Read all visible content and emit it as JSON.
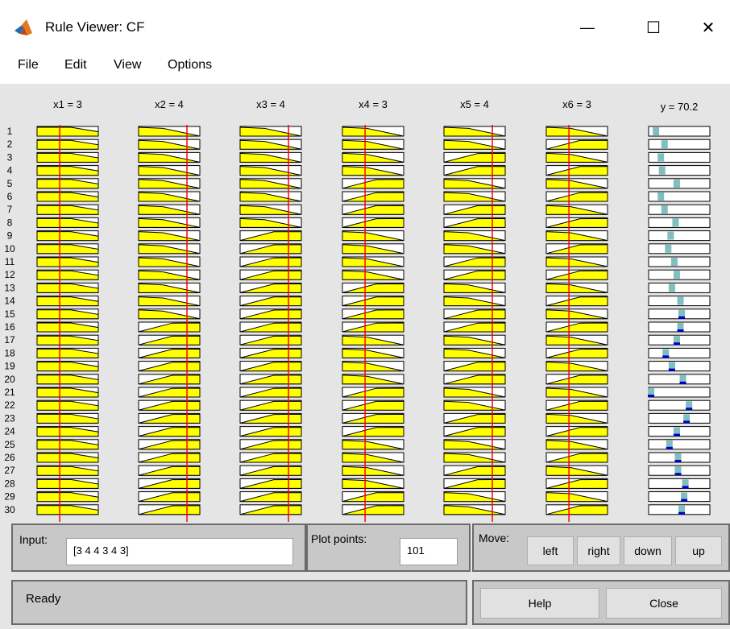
{
  "window": {
    "title": "Rule Viewer: CF",
    "minimize_glyph": "—",
    "maximize_glyph": "☐",
    "close_glyph": "✕"
  },
  "menu": [
    "File",
    "Edit",
    "View",
    "Options"
  ],
  "plot": {
    "input_headers": [
      "x1 = 3",
      "x2 = 4",
      "x3 = 4",
      "x4 = 3",
      "x5 = 4",
      "x6 = 3"
    ],
    "output_header": "y = 70.2",
    "rule_numbers": [
      "1",
      "2",
      "3",
      "4",
      "5",
      "6",
      "7",
      "8",
      "9",
      "10",
      "11",
      "12",
      "13",
      "14",
      "15",
      "16",
      "17",
      "18",
      "19",
      "20",
      "21",
      "22",
      "23",
      "24",
      "25",
      "26",
      "27",
      "28",
      "29",
      "30"
    ],
    "input_values_fraction": [
      0.37,
      0.79,
      0.79,
      0.37,
      0.79,
      0.37
    ],
    "input_mf_shapes": [
      [
        "F",
        "F",
        "F",
        "F",
        "F",
        "F",
        "F",
        "F",
        "F",
        "F",
        "F",
        "F",
        "F",
        "F",
        "F",
        "F",
        "F",
        "F",
        "F",
        "F",
        "F",
        "F",
        "F",
        "F",
        "F",
        "F",
        "F",
        "F",
        "F",
        "F"
      ],
      [
        "D",
        "D",
        "D",
        "D",
        "D",
        "D",
        "D",
        "D",
        "D",
        "D",
        "D",
        "D",
        "D",
        "D",
        "D",
        "U",
        "U",
        "U",
        "U",
        "U",
        "U",
        "U",
        "U",
        "U",
        "U",
        "U",
        "U",
        "U",
        "U",
        "U"
      ],
      [
        "D",
        "D",
        "D",
        "D",
        "D",
        "D",
        "D",
        "D",
        "U",
        "U",
        "U",
        "U",
        "U",
        "U",
        "U",
        "U",
        "U",
        "U",
        "U",
        "U",
        "U",
        "U",
        "U",
        "U",
        "U",
        "U",
        "U",
        "U",
        "U",
        "U"
      ],
      [
        "D",
        "D",
        "D",
        "D",
        "U",
        "U",
        "U",
        "U",
        "D",
        "D",
        "D",
        "D",
        "U",
        "U",
        "U",
        "U",
        "D",
        "D",
        "D",
        "D",
        "U",
        "U",
        "U",
        "U",
        "D",
        "D",
        "D",
        "D",
        "U",
        "U"
      ],
      [
        "D",
        "D",
        "U",
        "U",
        "D",
        "D",
        "U",
        "U",
        "D",
        "D",
        "U",
        "U",
        "D",
        "D",
        "U",
        "U",
        "D",
        "D",
        "U",
        "U",
        "D",
        "D",
        "U",
        "U",
        "D",
        "D",
        "U",
        "U",
        "D",
        "D"
      ],
      [
        "D",
        "U",
        "D",
        "U",
        "D",
        "U",
        "D",
        "U",
        "D",
        "U",
        "D",
        "U",
        "D",
        "U",
        "D",
        "U",
        "D",
        "U",
        "D",
        "U",
        "D",
        "U",
        "D",
        "U",
        "D",
        "U",
        "D",
        "U",
        "D",
        "U"
      ]
    ],
    "output_rule_levels": [
      0.12,
      0.26,
      0.2,
      0.22,
      0.46,
      0.2,
      0.26,
      0.44,
      0.36,
      0.32,
      0.42,
      0.46,
      0.38,
      0.52,
      0.54,
      0.52,
      0.46,
      0.28,
      0.38,
      0.56,
      0.04,
      0.66,
      0.62,
      0.46,
      0.34,
      0.48,
      0.48,
      0.6,
      0.58,
      0.54
    ],
    "colors": {
      "background": "#e5e5e5",
      "mf_fill": "#ffff00",
      "mf_edge": "#000000",
      "input_line": "#ff0000",
      "output_marker": "#7fbfbf",
      "output_marker_dark": "#0000cc"
    }
  },
  "input": {
    "label": "Input:",
    "value": "[3 4 4 3 4 3]"
  },
  "plot_points": {
    "label": "Plot points:",
    "value": "101"
  },
  "move": {
    "label": "Move:",
    "left": "left",
    "right": "right",
    "down": "down",
    "up": "up"
  },
  "status": {
    "text": "Ready"
  },
  "buttons": {
    "help": "Help",
    "close": "Close"
  }
}
